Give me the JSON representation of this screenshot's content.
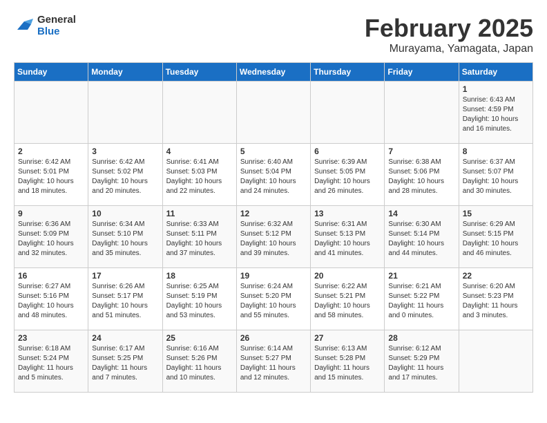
{
  "header": {
    "logo_line1": "General",
    "logo_line2": "Blue",
    "month": "February 2025",
    "location": "Murayama, Yamagata, Japan"
  },
  "weekdays": [
    "Sunday",
    "Monday",
    "Tuesday",
    "Wednesday",
    "Thursday",
    "Friday",
    "Saturday"
  ],
  "weeks": [
    [
      {
        "day": "",
        "info": ""
      },
      {
        "day": "",
        "info": ""
      },
      {
        "day": "",
        "info": ""
      },
      {
        "day": "",
        "info": ""
      },
      {
        "day": "",
        "info": ""
      },
      {
        "day": "",
        "info": ""
      },
      {
        "day": "1",
        "info": "Sunrise: 6:43 AM\nSunset: 4:59 PM\nDaylight: 10 hours and 16 minutes."
      }
    ],
    [
      {
        "day": "2",
        "info": "Sunrise: 6:42 AM\nSunset: 5:01 PM\nDaylight: 10 hours and 18 minutes."
      },
      {
        "day": "3",
        "info": "Sunrise: 6:42 AM\nSunset: 5:02 PM\nDaylight: 10 hours and 20 minutes."
      },
      {
        "day": "4",
        "info": "Sunrise: 6:41 AM\nSunset: 5:03 PM\nDaylight: 10 hours and 22 minutes."
      },
      {
        "day": "5",
        "info": "Sunrise: 6:40 AM\nSunset: 5:04 PM\nDaylight: 10 hours and 24 minutes."
      },
      {
        "day": "6",
        "info": "Sunrise: 6:39 AM\nSunset: 5:05 PM\nDaylight: 10 hours and 26 minutes."
      },
      {
        "day": "7",
        "info": "Sunrise: 6:38 AM\nSunset: 5:06 PM\nDaylight: 10 hours and 28 minutes."
      },
      {
        "day": "8",
        "info": "Sunrise: 6:37 AM\nSunset: 5:07 PM\nDaylight: 10 hours and 30 minutes."
      }
    ],
    [
      {
        "day": "9",
        "info": "Sunrise: 6:36 AM\nSunset: 5:09 PM\nDaylight: 10 hours and 32 minutes."
      },
      {
        "day": "10",
        "info": "Sunrise: 6:34 AM\nSunset: 5:10 PM\nDaylight: 10 hours and 35 minutes."
      },
      {
        "day": "11",
        "info": "Sunrise: 6:33 AM\nSunset: 5:11 PM\nDaylight: 10 hours and 37 minutes."
      },
      {
        "day": "12",
        "info": "Sunrise: 6:32 AM\nSunset: 5:12 PM\nDaylight: 10 hours and 39 minutes."
      },
      {
        "day": "13",
        "info": "Sunrise: 6:31 AM\nSunset: 5:13 PM\nDaylight: 10 hours and 41 minutes."
      },
      {
        "day": "14",
        "info": "Sunrise: 6:30 AM\nSunset: 5:14 PM\nDaylight: 10 hours and 44 minutes."
      },
      {
        "day": "15",
        "info": "Sunrise: 6:29 AM\nSunset: 5:15 PM\nDaylight: 10 hours and 46 minutes."
      }
    ],
    [
      {
        "day": "16",
        "info": "Sunrise: 6:27 AM\nSunset: 5:16 PM\nDaylight: 10 hours and 48 minutes."
      },
      {
        "day": "17",
        "info": "Sunrise: 6:26 AM\nSunset: 5:17 PM\nDaylight: 10 hours and 51 minutes."
      },
      {
        "day": "18",
        "info": "Sunrise: 6:25 AM\nSunset: 5:19 PM\nDaylight: 10 hours and 53 minutes."
      },
      {
        "day": "19",
        "info": "Sunrise: 6:24 AM\nSunset: 5:20 PM\nDaylight: 10 hours and 55 minutes."
      },
      {
        "day": "20",
        "info": "Sunrise: 6:22 AM\nSunset: 5:21 PM\nDaylight: 10 hours and 58 minutes."
      },
      {
        "day": "21",
        "info": "Sunrise: 6:21 AM\nSunset: 5:22 PM\nDaylight: 11 hours and 0 minutes."
      },
      {
        "day": "22",
        "info": "Sunrise: 6:20 AM\nSunset: 5:23 PM\nDaylight: 11 hours and 3 minutes."
      }
    ],
    [
      {
        "day": "23",
        "info": "Sunrise: 6:18 AM\nSunset: 5:24 PM\nDaylight: 11 hours and 5 minutes."
      },
      {
        "day": "24",
        "info": "Sunrise: 6:17 AM\nSunset: 5:25 PM\nDaylight: 11 hours and 7 minutes."
      },
      {
        "day": "25",
        "info": "Sunrise: 6:16 AM\nSunset: 5:26 PM\nDaylight: 11 hours and 10 minutes."
      },
      {
        "day": "26",
        "info": "Sunrise: 6:14 AM\nSunset: 5:27 PM\nDaylight: 11 hours and 12 minutes."
      },
      {
        "day": "27",
        "info": "Sunrise: 6:13 AM\nSunset: 5:28 PM\nDaylight: 11 hours and 15 minutes."
      },
      {
        "day": "28",
        "info": "Sunrise: 6:12 AM\nSunset: 5:29 PM\nDaylight: 11 hours and 17 minutes."
      },
      {
        "day": "",
        "info": ""
      }
    ]
  ]
}
